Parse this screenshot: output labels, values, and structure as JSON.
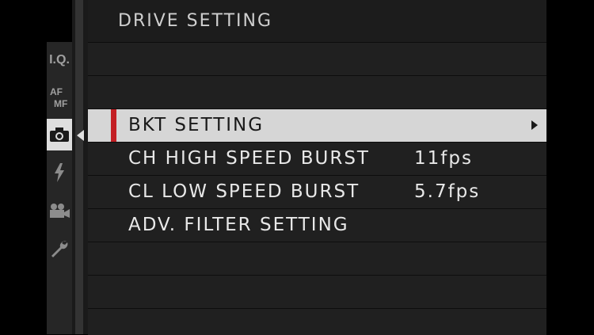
{
  "menu": {
    "title": "DRIVE SETTING",
    "items": [
      {
        "label": "",
        "value": ""
      },
      {
        "label": "",
        "value": ""
      },
      {
        "label": "BKT SETTING",
        "value": "",
        "selected": true
      },
      {
        "label": "CH HIGH SPEED BURST",
        "value": "11fps"
      },
      {
        "label": "CL LOW SPEED BURST",
        "value": "5.7fps"
      },
      {
        "label": "ADV. FILTER SETTING",
        "value": ""
      },
      {
        "label": "",
        "value": ""
      },
      {
        "label": "",
        "value": ""
      }
    ]
  },
  "tabs": [
    {
      "name": "image-quality-tab",
      "text": "I.Q.",
      "icon": "iq-icon"
    },
    {
      "name": "focus-tab",
      "text": "AF MF",
      "icon": "af-mf-icon"
    },
    {
      "name": "shooting-tab",
      "text": "",
      "icon": "camera-icon",
      "active": true
    },
    {
      "name": "flash-tab",
      "text": "",
      "icon": "flash-icon"
    },
    {
      "name": "movie-tab",
      "text": "",
      "icon": "movie-camera-icon"
    },
    {
      "name": "setup-tab",
      "text": "",
      "icon": "wrench-icon"
    }
  ],
  "colors": {
    "accent": "#c31f24",
    "selected_row": "#d6d6d6",
    "active_tab": "#dedede",
    "panel": "#1c1c1c"
  }
}
